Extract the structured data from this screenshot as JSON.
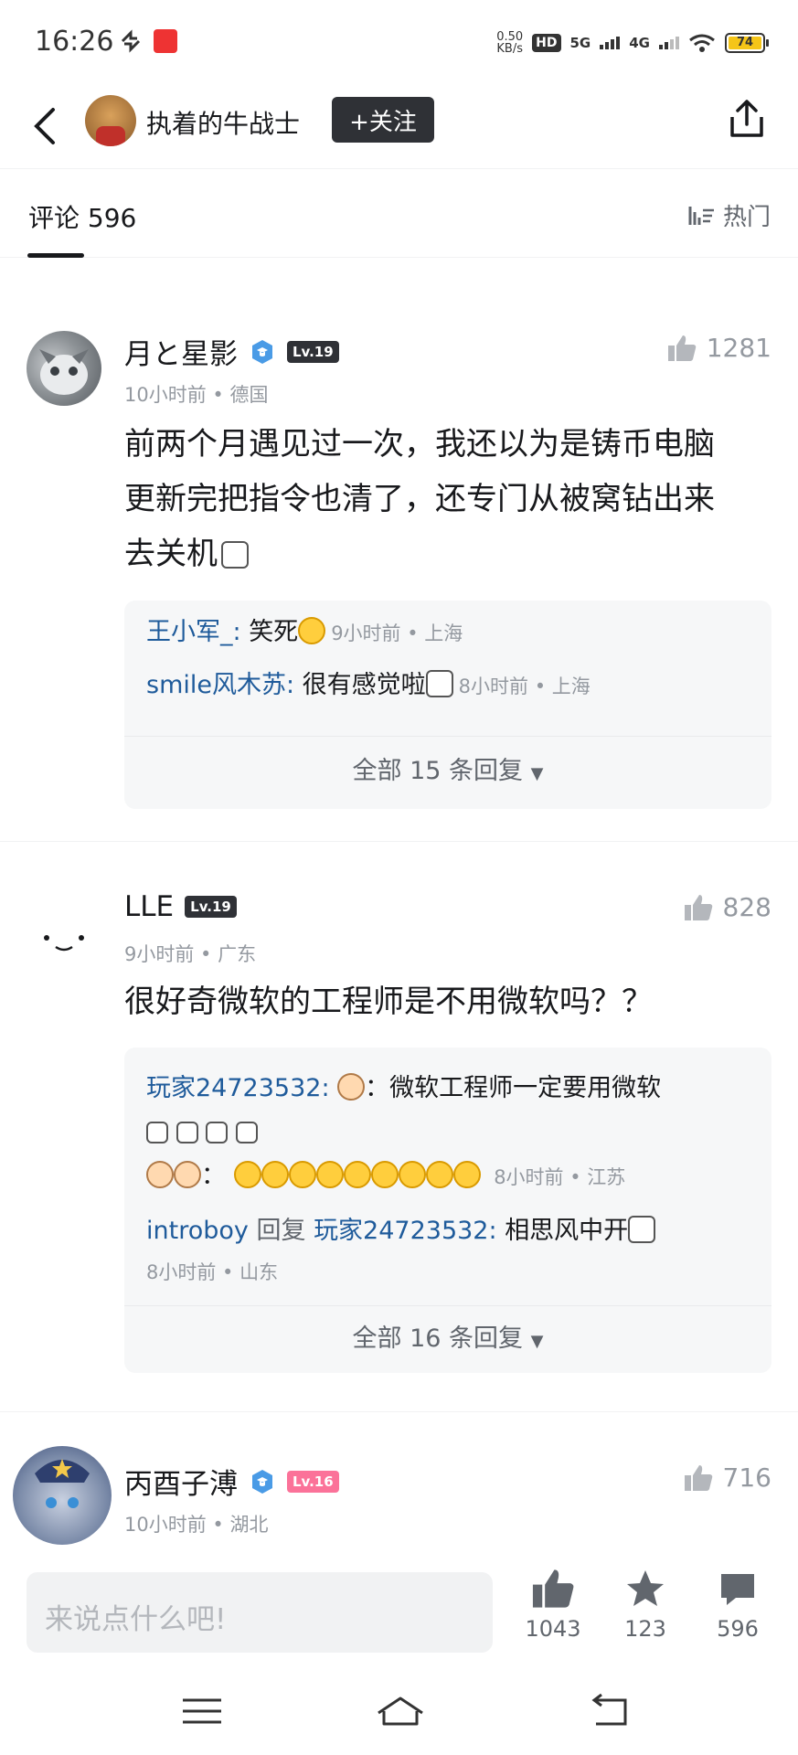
{
  "status": {
    "time": "16:26",
    "speed_top": "0.50",
    "speed_unit": "KB/s",
    "hd": "HD",
    "sim1": "5G",
    "sim2": "4G",
    "battery": "74"
  },
  "header": {
    "author": "执着的牛战士",
    "follow_label": "+关注"
  },
  "comments_header": {
    "title": "评论 596",
    "sort_label": "热门"
  },
  "comments": [
    {
      "username": "月と星影",
      "level": "Lv.19",
      "meta": "10小时前 • 德国",
      "likes": "1281",
      "content_lines": [
        "前两个月遇见过一次，我还以为是铸币电脑",
        "更新完把指令也清了，还专门从被窝钻出来",
        "去关机"
      ],
      "replies": [
        {
          "user": "王小军_",
          "text": "笑死",
          "meta": "9小时前 • 上海"
        },
        {
          "user": "smile风木苏",
          "text": "很有感觉啦",
          "meta": "8小时前 • 上海"
        }
      ],
      "more": "全部 15 条回复"
    },
    {
      "username": "LLE",
      "level": "Lv.19",
      "meta": "9小时前 • 广东",
      "likes": "828",
      "content_lines": [
        "很好奇微软的工程师是不用微软吗？？"
      ],
      "replies": [
        {
          "user": "玩家24723532",
          "text": "：微软工程师一定要用微软",
          "meta": "8小时前 • 江苏"
        },
        {
          "user": "introboy",
          "reply_word": "回复",
          "reply_target": "玩家24723532:",
          "text": "相思风中开",
          "meta": "8小时前 • 山东"
        }
      ],
      "more": "全部 16 条回复"
    },
    {
      "username": "丙酉子溥",
      "level": "Lv.16",
      "meta": "10小时前 • 湖北",
      "likes": "716"
    }
  ],
  "bottom": {
    "placeholder": "来说点什么吧!",
    "likes": "1043",
    "stars": "123",
    "comments": "596"
  }
}
